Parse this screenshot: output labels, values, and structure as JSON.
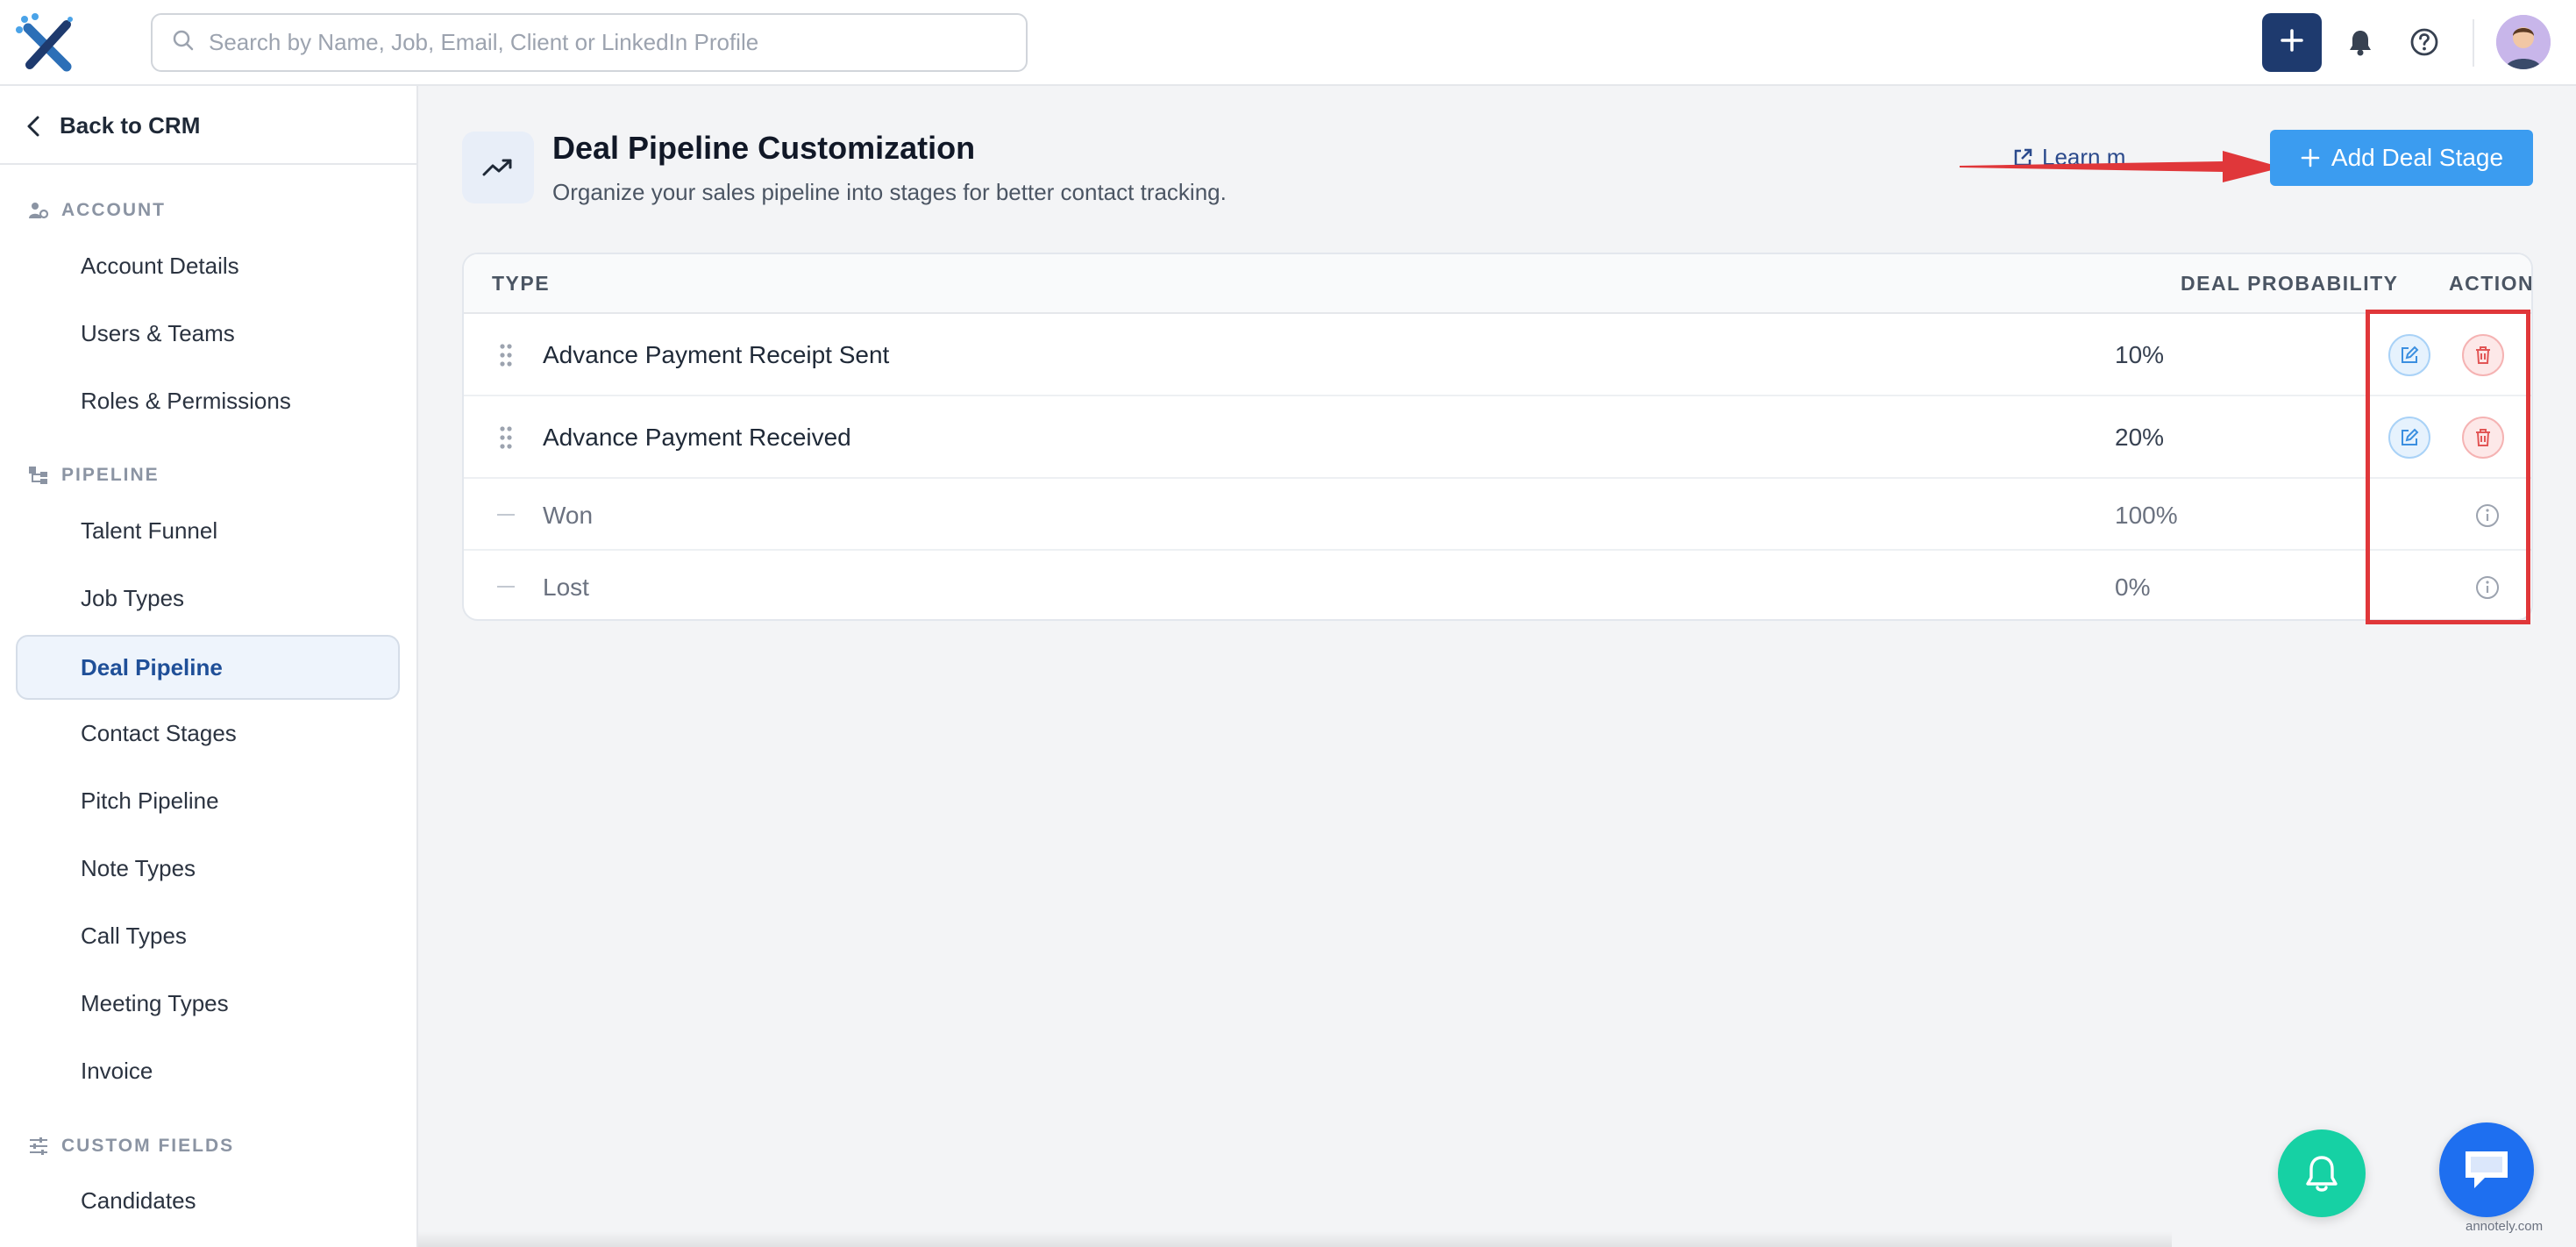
{
  "topbar": {
    "search_placeholder": "Search by Name, Job, Email, Client or LinkedIn Profile"
  },
  "sidebar": {
    "back_label": "Back to CRM",
    "sections": {
      "account": "ACCOUNT",
      "pipeline": "PIPELINE",
      "custom_fields": "CUSTOM FIELDS"
    },
    "account_items": [
      "Account Details",
      "Users & Teams",
      "Roles & Permissions"
    ],
    "pipeline_items": [
      "Talent Funnel",
      "Job Types",
      "Deal Pipeline",
      "Contact Stages",
      "Pitch Pipeline",
      "Note Types",
      "Call Types",
      "Meeting Types",
      "Invoice"
    ],
    "custom_field_items": [
      "Candidates"
    ],
    "active_item": "Deal Pipeline"
  },
  "header": {
    "title": "Deal Pipeline Customization",
    "subtitle": "Organize your sales pipeline into stages for better contact tracking.",
    "learn_link": "Learn m",
    "add_button": "Add Deal Stage"
  },
  "table": {
    "columns": {
      "type": "TYPE",
      "probability": "DEAL PROBABILITY",
      "actions": "ACTIONS"
    },
    "rows": [
      {
        "name": "Advance Payment Receipt Sent",
        "probability": "10%",
        "editable": true
      },
      {
        "name": "Advance Payment Received",
        "probability": "20%",
        "editable": true
      },
      {
        "name": "Won",
        "probability": "100%",
        "editable": false
      },
      {
        "name": "Lost",
        "probability": "0%",
        "editable": false
      }
    ]
  },
  "watermark": "annotely.com",
  "colors": {
    "primary_navy": "#1e3a6e",
    "accent_blue": "#3b9cf0",
    "annotation_red": "#e0373a",
    "fab_green": "#16d1a4",
    "fab_blue": "#1e6ff0"
  },
  "icons": {
    "logo": "logo-icon",
    "search": "search-icon",
    "plus": "plus-icon",
    "bell": "bell-icon",
    "help": "help-icon",
    "chevron_left": "chevron-left-icon",
    "trend": "trending-up-icon",
    "external_link": "external-link-icon",
    "drag": "drag-handle-icon",
    "edit": "edit-icon",
    "delete": "trash-icon",
    "info": "info-icon",
    "chat": "chat-icon"
  }
}
